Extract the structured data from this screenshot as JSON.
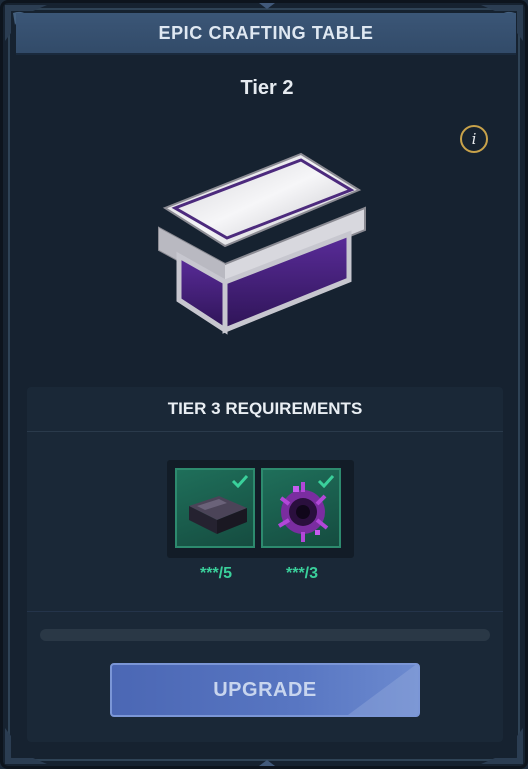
{
  "window": {
    "title": "EPIC CRAFTING TABLE"
  },
  "tier": {
    "label": "Tier 2"
  },
  "info": {
    "icon": "info-icon",
    "glyph": "i"
  },
  "requirements": {
    "title": "TIER 3 REQUIREMENTS",
    "items": [
      {
        "icon": "obsidian-ingot-icon",
        "count": "***/5",
        "met": true
      },
      {
        "icon": "void-essence-icon",
        "count": "***/3",
        "met": true
      }
    ],
    "progress": 0
  },
  "actions": {
    "upgrade_label": "UPGRADE"
  },
  "colors": {
    "accent_green": "#3ad09b",
    "title_bar": "#3b5677",
    "button": "#5876c2",
    "info_ring": "#c8a24a"
  }
}
